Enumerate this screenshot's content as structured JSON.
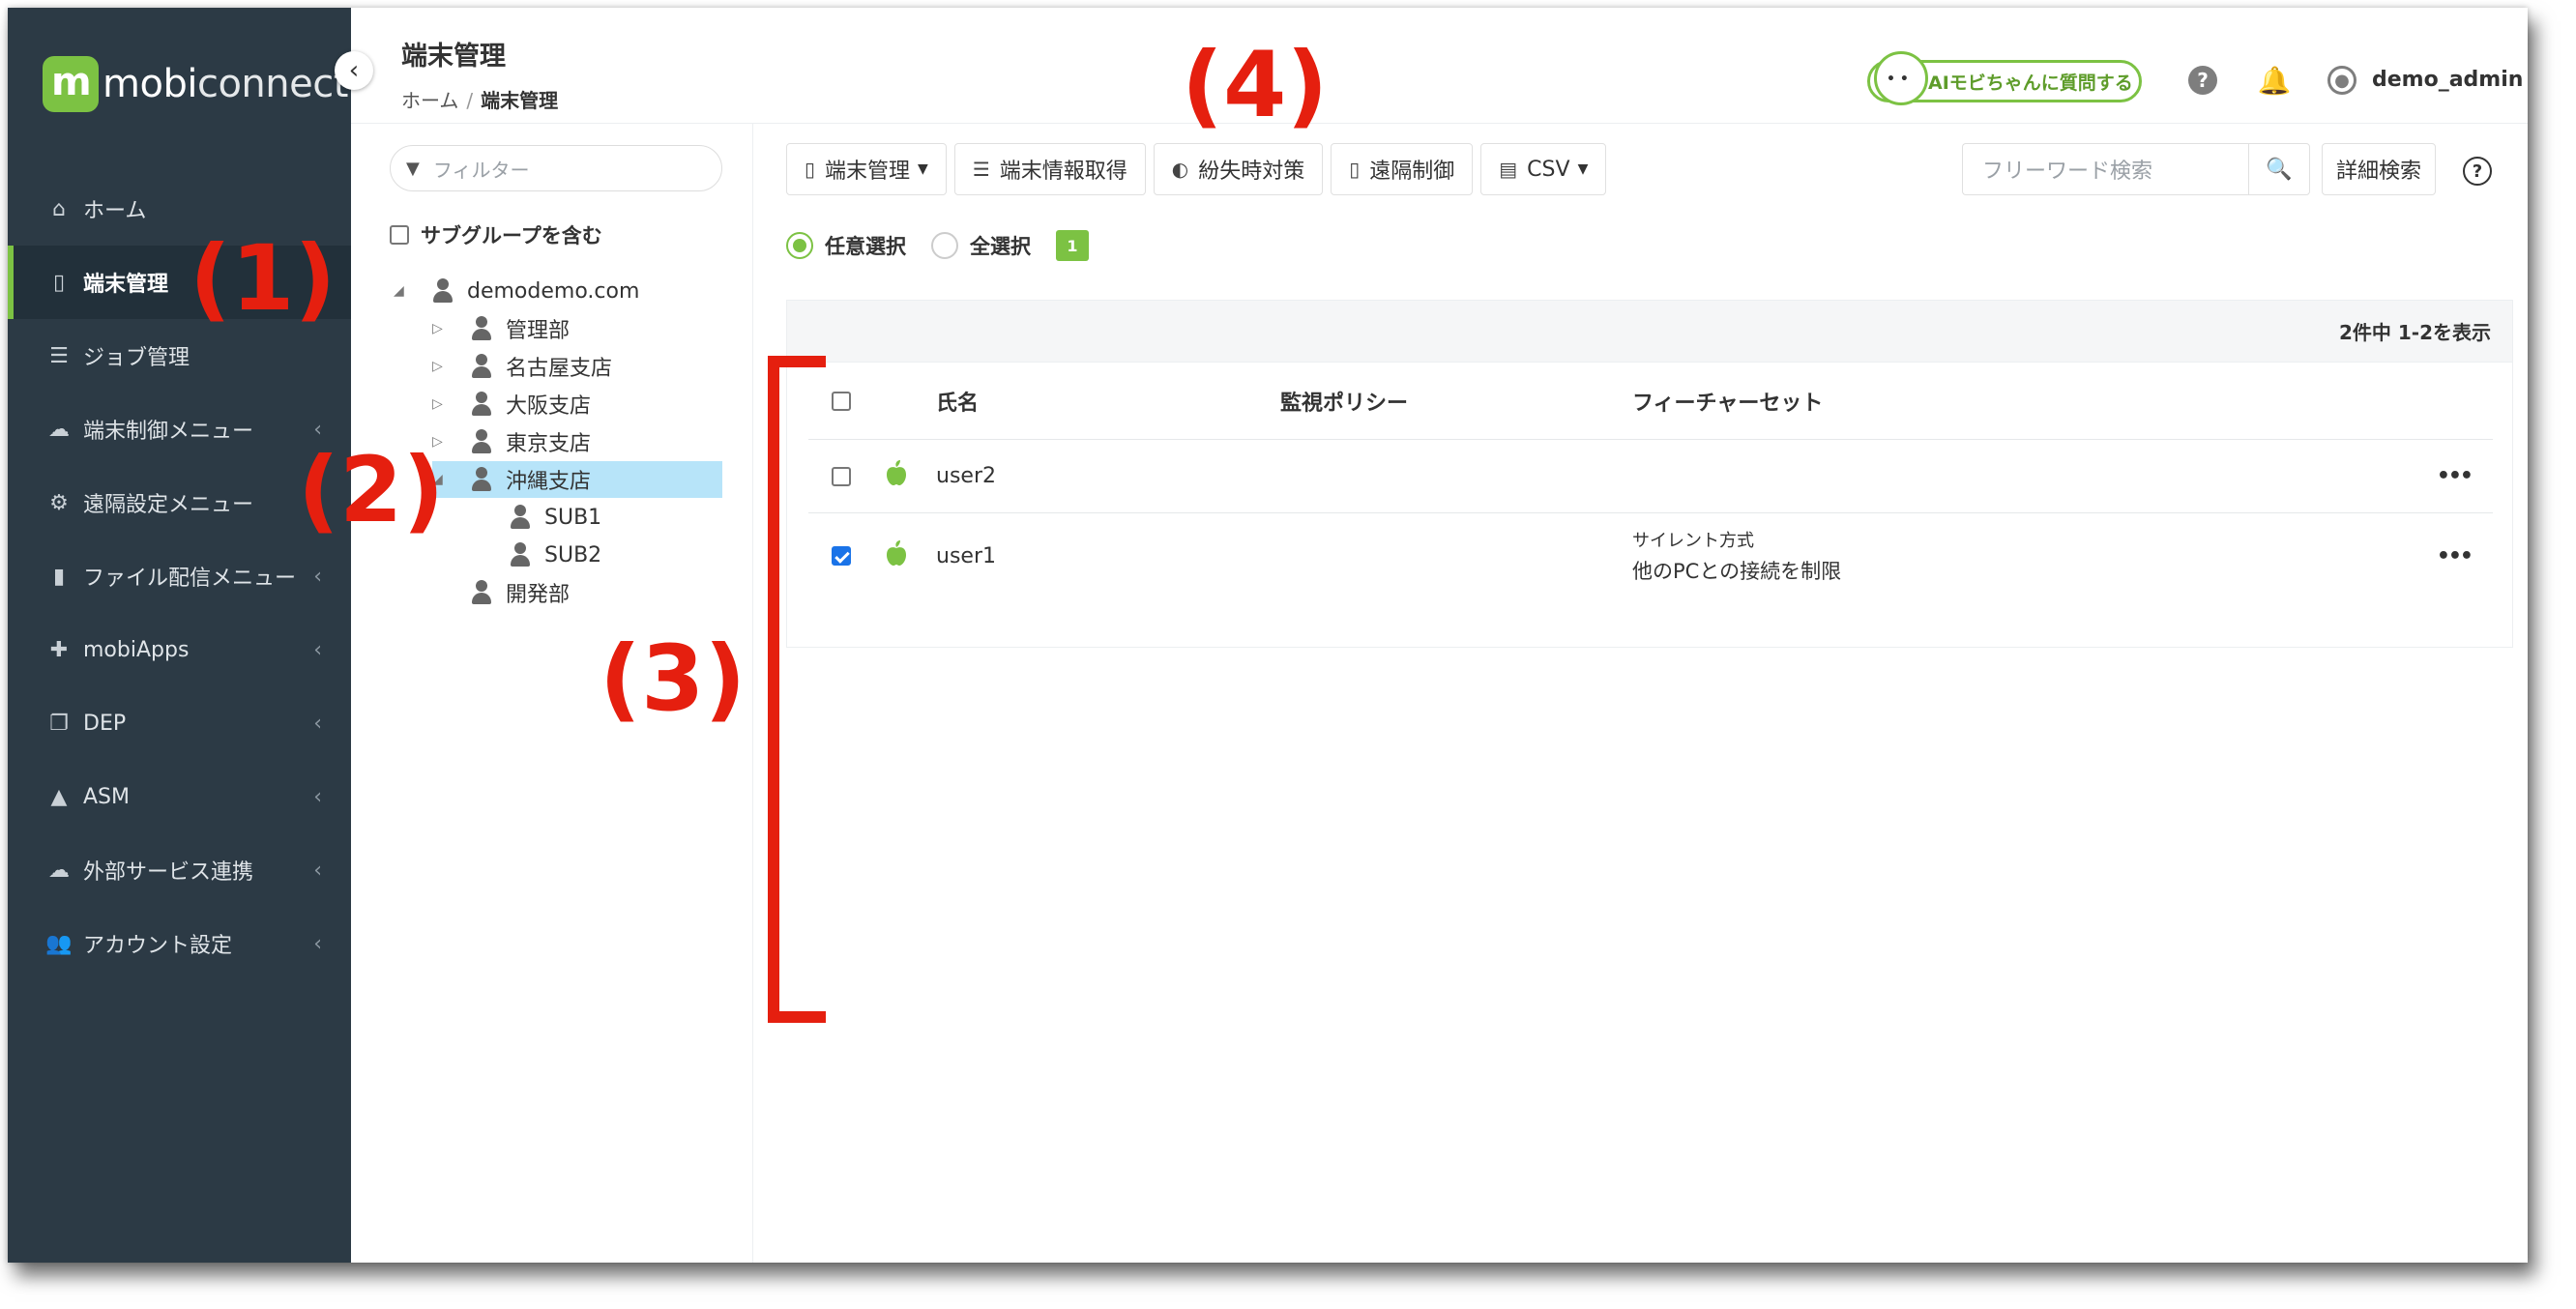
{
  "brand": {
    "part1": "mobi",
    "part2": "connect"
  },
  "sidebar": {
    "items": [
      {
        "label": "ホーム",
        "icon": "home-icon",
        "glyph": "⌂",
        "chevron": ""
      },
      {
        "label": "端末管理",
        "icon": "mobile-icon",
        "glyph": "▯",
        "chevron": ""
      },
      {
        "label": "ジョブ管理",
        "icon": "server-icon",
        "glyph": "☰",
        "chevron": ""
      },
      {
        "label": "端末制御メニュー",
        "icon": "cloud-icon",
        "glyph": "☁",
        "chevron": "‹"
      },
      {
        "label": "遠隔設定メニュー",
        "icon": "gears-icon",
        "glyph": "⚙",
        "chevron": "‹"
      },
      {
        "label": "ファイル配信メニュー",
        "icon": "file-icon",
        "glyph": "▮",
        "chevron": "‹"
      },
      {
        "label": "mobiApps",
        "icon": "puzzle-icon",
        "glyph": "✚",
        "chevron": "‹"
      },
      {
        "label": "DEP",
        "icon": "copy-icon",
        "glyph": "❐",
        "chevron": "‹"
      },
      {
        "label": "ASM",
        "icon": "graduation-cap-icon",
        "glyph": "▲",
        "chevron": "‹"
      },
      {
        "label": "外部サービス連携",
        "icon": "cloud-icon",
        "glyph": "☁",
        "chevron": "‹"
      },
      {
        "label": "アカウント設定",
        "icon": "users-icon",
        "glyph": "👥",
        "chevron": "‹"
      }
    ]
  },
  "header": {
    "title": "端末管理",
    "breadcrumb": {
      "home": "ホーム",
      "sep": "/",
      "current": "端末管理"
    },
    "ai_badge": "AIモビちゃんに質問する",
    "username": "demo_admin"
  },
  "tree": {
    "filter_placeholder": "フィルター",
    "include_subgroups": "サブグループを含む",
    "nodes": [
      {
        "label": "demodemo.com",
        "toggle": "◢"
      },
      {
        "label": "管理部",
        "toggle": "▷"
      },
      {
        "label": "名古屋支店",
        "toggle": "▷"
      },
      {
        "label": "大阪支店",
        "toggle": "▷"
      },
      {
        "label": "東京支店",
        "toggle": "▷"
      },
      {
        "label": "沖縄支店",
        "toggle": "◢"
      },
      {
        "label": "SUB1",
        "toggle": ""
      },
      {
        "label": "SUB2",
        "toggle": ""
      },
      {
        "label": "開発部",
        "toggle": ""
      }
    ]
  },
  "toolbar": {
    "device_mgmt": "端末管理",
    "get_info": "端末情報取得",
    "loss_measures": "紛失時対策",
    "remote_control": "遠隔制御",
    "csv": "CSV",
    "search_placeholder": "フリーワード検索",
    "advanced_search": "詳細検索"
  },
  "selection": {
    "arbitrary": "任意選択",
    "all": "全選択",
    "count": "1"
  },
  "list": {
    "summary": "2件中 1-2を表示",
    "columns": {
      "name": "氏名",
      "policy": "監視ポリシー",
      "feature": "フィーチャーセット"
    },
    "rows": [
      {
        "name": "user2",
        "policy": "",
        "feature_top": "",
        "feature_bottom": "",
        "checked": false
      },
      {
        "name": "user1",
        "policy": "",
        "feature_top": "サイレント方式",
        "feature_bottom": "他のPCとの接続を制限",
        "checked": true
      }
    ],
    "more": "•••"
  },
  "annotations": {
    "a1": "(1)",
    "a2": "(2)",
    "a3": "(3)",
    "a4": "(4)"
  },
  "colors": {
    "accent": "#7cc243",
    "sidebar": "#2c3a45",
    "annotation": "#e51f0f",
    "selected_node": "#b7e4f9"
  }
}
